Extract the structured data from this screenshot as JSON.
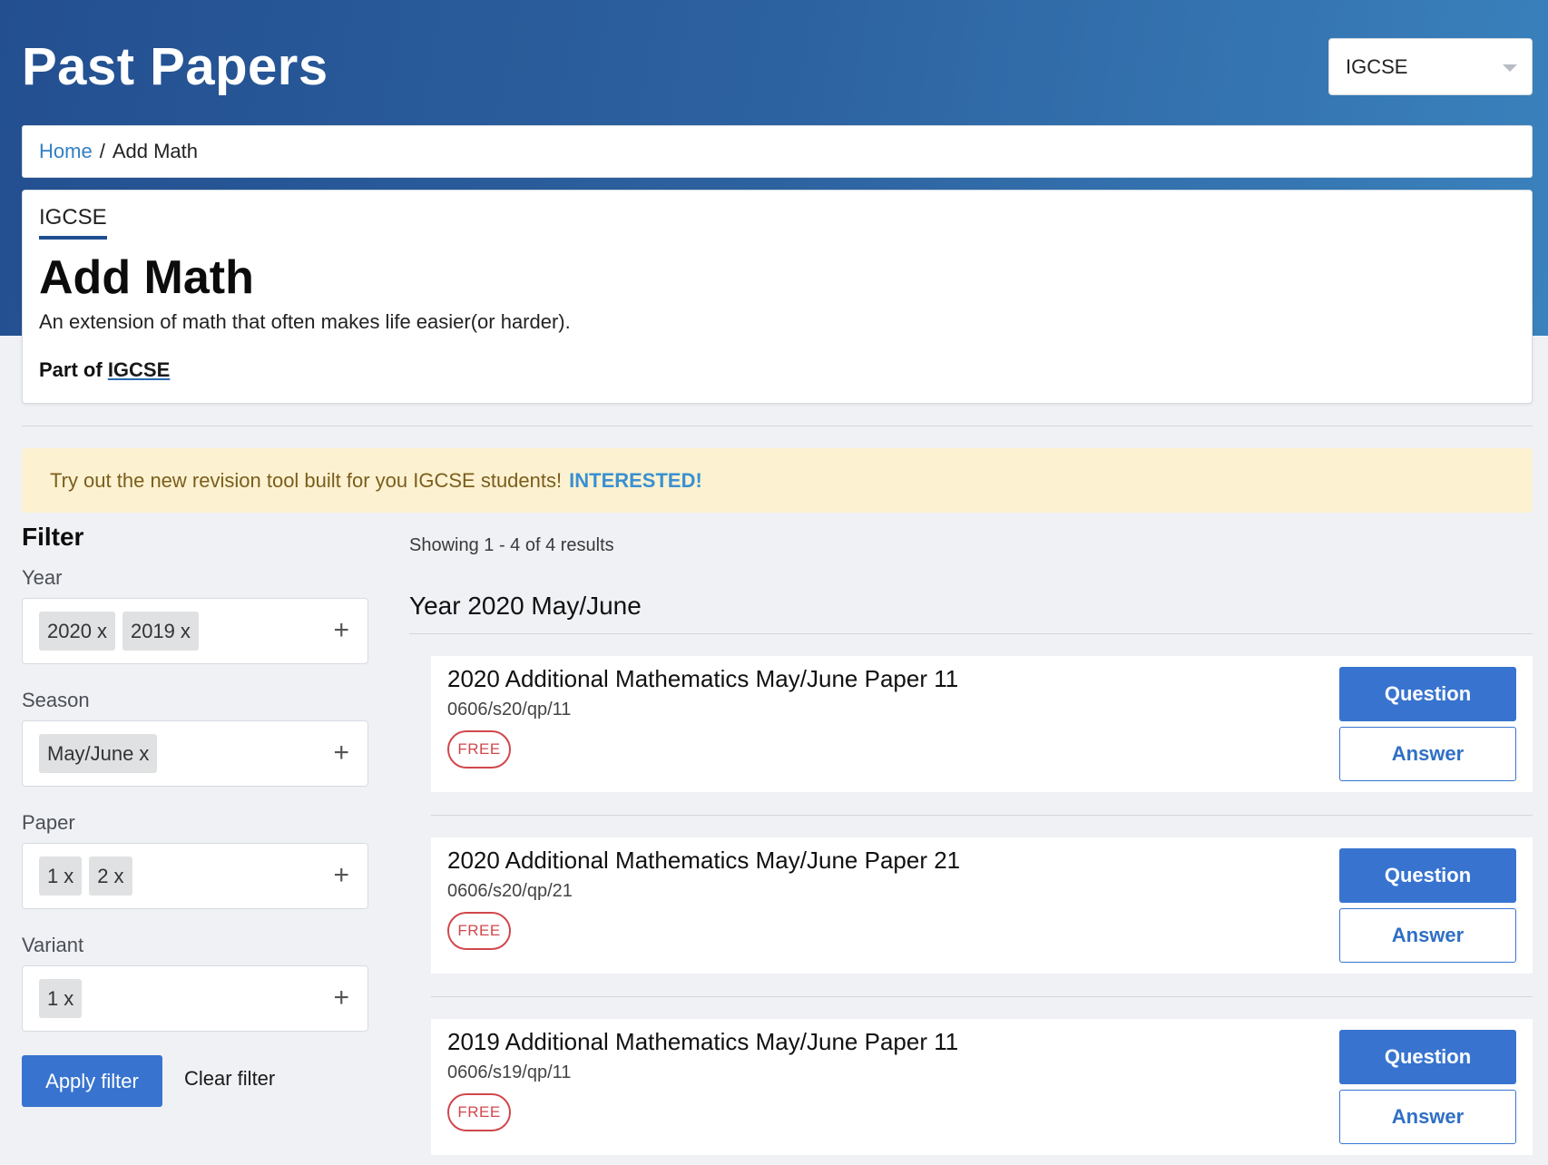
{
  "header": {
    "site_title": "Past Papers",
    "level_select": {
      "selected": "IGCSE"
    }
  },
  "breadcrumb": {
    "home_label": "Home",
    "separator": "/",
    "current": "Add Math"
  },
  "subject": {
    "tag": "IGCSE",
    "title": "Add Math",
    "description": "An extension of math that often makes life easier(or harder).",
    "part_of_prefix": "Part of",
    "part_of_link": "IGCSE"
  },
  "banner": {
    "text": "Try out the new revision tool built for you IGCSE students!",
    "link_label": "INTERESTED!"
  },
  "filter": {
    "heading": "Filter",
    "groups": [
      {
        "label": "Year",
        "chips": [
          "2020",
          "2019"
        ]
      },
      {
        "label": "Season",
        "chips": [
          "May/June"
        ]
      },
      {
        "label": "Paper",
        "chips": [
          "1",
          "2"
        ]
      },
      {
        "label": "Variant",
        "chips": [
          "1"
        ]
      }
    ],
    "chip_remove": "x",
    "add_icon": "+",
    "apply_label": "Apply filter",
    "clear_label": "Clear filter"
  },
  "results": {
    "summary": "Showing 1 - 4 of 4 results",
    "group_title": "Year 2020 May/June",
    "papers": [
      {
        "title": "2020 Additional Mathematics May/June Paper 11",
        "code": "0606/s20/qp/11",
        "badge": "FREE",
        "question_label": "Question",
        "answer_label": "Answer"
      },
      {
        "title": "2020 Additional Mathematics May/June Paper 21",
        "code": "0606/s20/qp/21",
        "badge": "FREE",
        "question_label": "Question",
        "answer_label": "Answer"
      },
      {
        "title": "2019 Additional Mathematics May/June Paper 11",
        "code": "0606/s19/qp/11",
        "badge": "FREE",
        "question_label": "Question",
        "answer_label": "Answer"
      }
    ]
  },
  "colors": {
    "header_gradient_start": "#234f90",
    "header_gradient_end": "#3a82bd",
    "primary_button": "#3874cf",
    "link": "#3380c4",
    "free_badge": "#d1474c",
    "banner_bg": "#fcf2d1"
  }
}
